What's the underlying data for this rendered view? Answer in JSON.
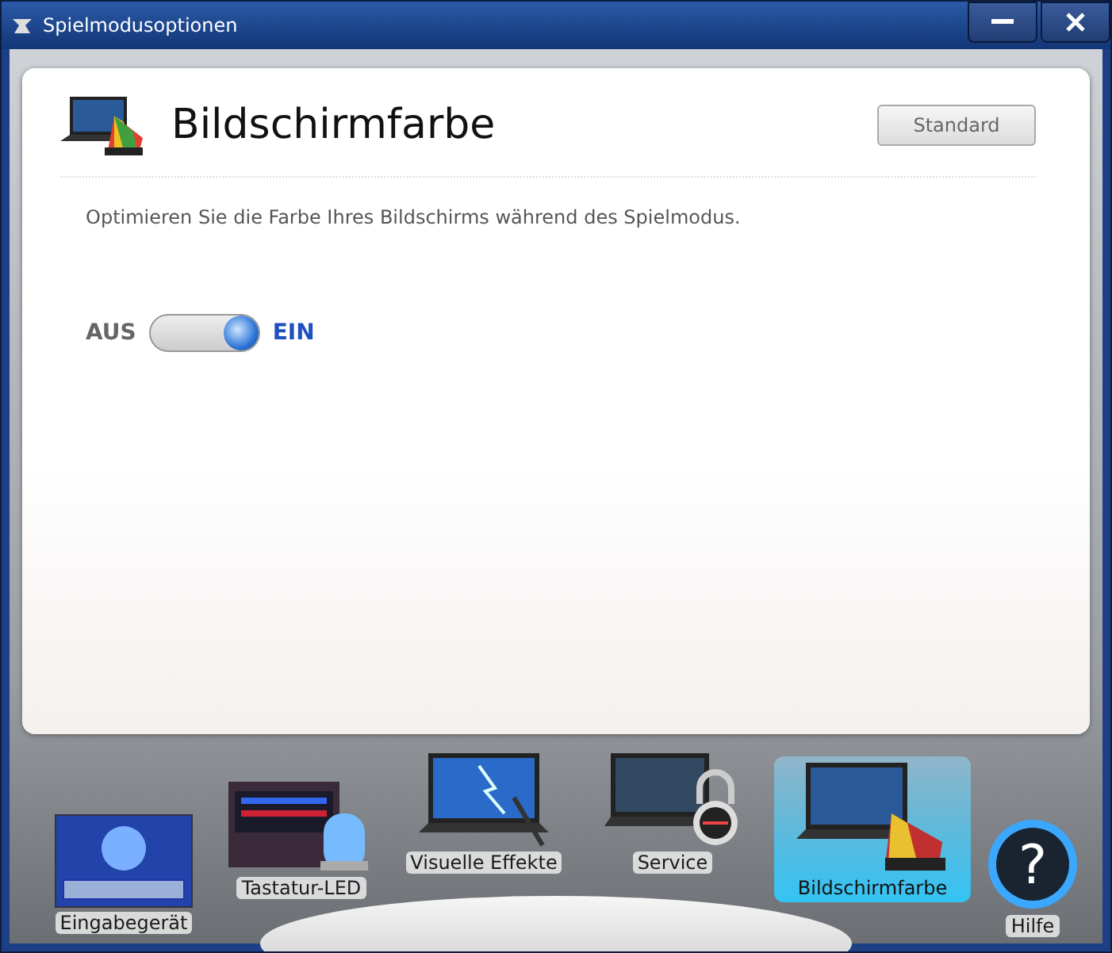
{
  "window": {
    "title": "Spielmodusoptionen"
  },
  "panel": {
    "title": "Bildschirmfarbe",
    "default_button": "Standard",
    "description": "Optimieren Sie die Farbe Ihres Bildschirms während des Spielmodus.",
    "toggle": {
      "off_label": "AUS",
      "on_label": "EIN",
      "on": true
    }
  },
  "nav": [
    {
      "label": "Eingabegerät",
      "kind": "touchpad",
      "selected": false
    },
    {
      "label": "Tastatur-LED",
      "kind": "keyboard",
      "selected": false
    },
    {
      "label": "Visuelle Effekte",
      "kind": "effects",
      "selected": false
    },
    {
      "label": "Service",
      "kind": "service",
      "selected": false
    },
    {
      "label": "Bildschirmfarbe",
      "kind": "color",
      "selected": true
    },
    {
      "label": "Hilfe",
      "kind": "help",
      "symbol": "?",
      "selected": false
    }
  ]
}
